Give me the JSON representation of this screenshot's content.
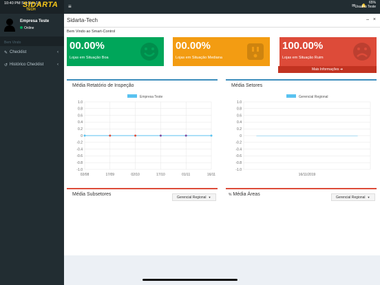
{
  "status": {
    "time": "10:40 PM   Sat Nov 16",
    "battery": "65%"
  },
  "brand": {
    "name": "SIDARTA",
    "sub": "TECH"
  },
  "user": {
    "name": "Empresa Teste",
    "status": "Online",
    "top_name": "Usuário Teste"
  },
  "sidebar": {
    "header": "Bem Vindo",
    "items": [
      {
        "icon": "edit-icon",
        "label": "Checklist"
      },
      {
        "icon": "history-icon",
        "label": "Histórico Checklist"
      }
    ]
  },
  "page": {
    "title": "Sidarta-Tech",
    "welcome": "Bem Vindo ao Smart-Control"
  },
  "stats": [
    {
      "value": "00.00%",
      "label": "Lojas em Situação Boa",
      "color": "#00a65a",
      "face": "smile"
    },
    {
      "value": "00.00%",
      "label": "Lojas em Situação Mediana",
      "color": "#f39c12",
      "face": "neutral"
    },
    {
      "value": "100.00%",
      "label": "Lojas em Situação Ruim",
      "color": "#dd4b39",
      "face": "sad",
      "more": "Mais Informações"
    }
  ],
  "panels": {
    "inspecao": {
      "title": "Média Retatório de Inspeção"
    },
    "setores": {
      "title": "Média Setores"
    },
    "subsetores": {
      "title": "Média Subsetores",
      "button": "Gerencial Regional"
    },
    "areas": {
      "title": "Média Áreas",
      "button": "Gerencial Regional"
    }
  },
  "chart_data": [
    {
      "type": "line",
      "legend": "Empresa Teste",
      "color": "#59c2f0",
      "x": [
        "02/08",
        "17/09",
        "02/10",
        "17/10",
        "01/11",
        "16/11"
      ],
      "values": [
        0,
        0,
        0,
        0,
        0,
        0
      ],
      "point_colors": [
        "#59c2f0",
        "#dd4b39",
        "#dd4b39",
        "#7d4b9e",
        "#7d4b9e",
        "#59c2f0"
      ],
      "yticks": [
        "1.0",
        "0.8",
        "0.6",
        "0.4",
        "0.2",
        "0",
        "-0.2",
        "-0.4",
        "-0.6",
        "-0.8",
        "-1.0"
      ],
      "ylim": [
        -1,
        1
      ]
    },
    {
      "type": "bar",
      "legend": "Gerencial Regional",
      "color": "#59c2f0",
      "categories": [
        "16/11/2019"
      ],
      "values": [
        0
      ],
      "yticks": [
        "1.0",
        "0.8",
        "0.6",
        "0.4",
        "0.2",
        "0",
        "-0.2",
        "-0.4",
        "-0.6",
        "-0.8",
        "-1.0"
      ],
      "ylim": [
        -1,
        1
      ]
    }
  ]
}
